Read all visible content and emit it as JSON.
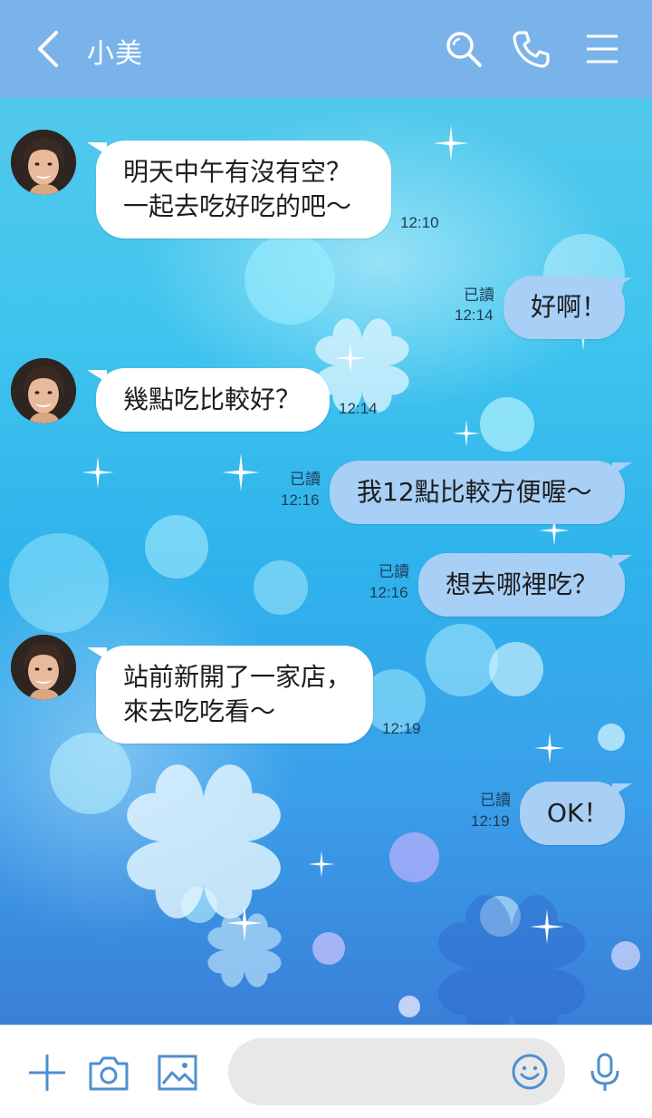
{
  "header": {
    "title": "小美",
    "back_icon": "chevron-left-icon",
    "actions": [
      "search-icon",
      "phone-icon",
      "menu-icon"
    ],
    "background_color": "#7ab3ea"
  },
  "messages": [
    {
      "from": "contact",
      "lines": [
        "明天中午有沒有空？",
        "一起去吃好吃的吧〜"
      ],
      "time": "12:10"
    },
    {
      "from": "me",
      "lines": [
        "好啊！"
      ],
      "read": "已讀",
      "time": "12:14"
    },
    {
      "from": "contact",
      "lines": [
        "幾點吃比較好？"
      ],
      "time": "12:14"
    },
    {
      "from": "me",
      "lines": [
        "我12點比較方便喔〜"
      ],
      "read": "已讀",
      "time": "12:16"
    },
    {
      "from": "me",
      "lines": [
        "想去哪裡吃？"
      ],
      "read": "已讀",
      "time": "12:16"
    },
    {
      "from": "contact",
      "lines": [
        "站前新開了一家店，",
        "來去吃吃看〜"
      ],
      "time": "12:19"
    },
    {
      "from": "me",
      "lines": [
        "OK！"
      ],
      "read": "已讀",
      "time": "12:19"
    }
  ],
  "input_bar": {
    "icons": [
      "plus-icon",
      "camera-icon",
      "image-icon",
      "smiley-icon",
      "microphone-icon"
    ],
    "placeholder": "",
    "accent_color": "#4f8fd0"
  },
  "colors": {
    "incoming_bubble": "#ffffff",
    "outgoing_bubble": "#a8cff5",
    "chat_background": "#3fb8ec"
  }
}
